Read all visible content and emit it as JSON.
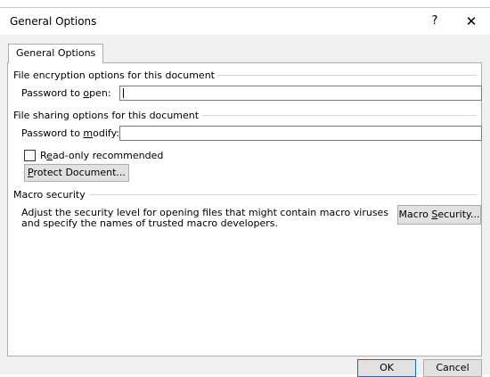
{
  "window": {
    "title": "General Options",
    "help_label": "?",
    "close_label": "✕"
  },
  "tab": {
    "label": "General Options"
  },
  "encryption": {
    "heading": "File encryption options for this document",
    "password_open_pre": "Password to ",
    "password_open_key": "o",
    "password_open_post": "pen:",
    "password_open_value": ""
  },
  "sharing": {
    "heading": "File sharing options for this document",
    "password_modify_pre": "Password to ",
    "password_modify_key": "m",
    "password_modify_post": "odify:",
    "password_modify_value": "",
    "readonly_pre": "R",
    "readonly_key": "e",
    "readonly_post": "ad-only recommended",
    "readonly_checked": false,
    "protect_pre": "",
    "protect_key": "P",
    "protect_post": "rotect Document..."
  },
  "macro": {
    "heading": "Macro security",
    "description": "Adjust the security level for opening files that might contain macro viruses and specify the names of trusted macro developers.",
    "button_pre": "Macro ",
    "button_key": "S",
    "button_post": "ecurity..."
  },
  "footer": {
    "ok_label": "OK",
    "cancel_label": "Cancel"
  }
}
